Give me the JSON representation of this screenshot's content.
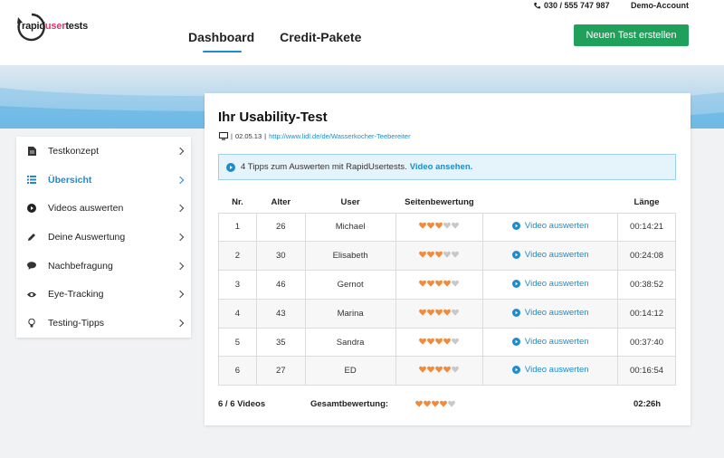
{
  "header": {
    "logo": {
      "part1": "rapid",
      "part2": "user",
      "part3": "tests"
    },
    "nav": [
      {
        "label": "Dashboard",
        "active": true
      },
      {
        "label": "Credit-Pakete",
        "active": false
      }
    ],
    "phone": "030 / 555 747 987",
    "account": "Demo-Account",
    "cta_label": "Neuen Test erstellen"
  },
  "colors": {
    "accent": "#1d8ccc",
    "cta": "#1fa05b",
    "heart_filled": "#f08a3c",
    "heart_empty": "#c8c8c8",
    "logo_pink": "#e8336b"
  },
  "sidebar": {
    "items": [
      {
        "label": "Testkonzept",
        "icon": "document-icon",
        "active": false
      },
      {
        "label": "Übersicht",
        "icon": "list-icon",
        "active": true
      },
      {
        "label": "Videos auswerten",
        "icon": "play-icon",
        "active": false
      },
      {
        "label": "Deine Auswertung",
        "icon": "pencil-icon",
        "active": false
      },
      {
        "label": "Nachbefragung",
        "icon": "speech-bubble-icon",
        "active": false
      },
      {
        "label": "Eye-Tracking",
        "icon": "eye-icon",
        "active": false
      },
      {
        "label": "Testing-Tipps",
        "icon": "lightbulb-icon",
        "active": false
      }
    ]
  },
  "main": {
    "title": "Ihr Usability-Test",
    "date": "02.05.13",
    "url": "http://www.lidl.de/de/Wasserkocher-Teebereiter",
    "tip_text": "4 Tipps zum Auswerten mit RapidUsertests.",
    "tip_link": "Video ansehen.",
    "table": {
      "headers": [
        "Nr.",
        "Alter",
        "User",
        "Seitenbewertung",
        "",
        "Länge"
      ],
      "rows": [
        {
          "nr": "1",
          "age": "26",
          "user": "Michael",
          "rating": 3,
          "video": "Video auswerten",
          "length": "00:14:21"
        },
        {
          "nr": "2",
          "age": "30",
          "user": "Elisabeth",
          "rating": 3,
          "video": "Video auswerten",
          "length": "00:24:08"
        },
        {
          "nr": "3",
          "age": "46",
          "user": "Gernot",
          "rating": 4,
          "video": "Video auswerten",
          "length": "00:38:52"
        },
        {
          "nr": "4",
          "age": "43",
          "user": "Marina",
          "rating": 4,
          "video": "Video auswerten",
          "length": "00:14:12"
        },
        {
          "nr": "5",
          "age": "35",
          "user": "Sandra",
          "rating": 4,
          "video": "Video auswerten",
          "length": "00:37:40"
        },
        {
          "nr": "6",
          "age": "27",
          "user": "ED",
          "rating": 4,
          "video": "Video auswerten",
          "length": "00:16:54"
        }
      ]
    },
    "footer": {
      "videos": "6 / 6 Videos",
      "total_label": "Gesamtbewertung:",
      "total_rating": 4,
      "total_length": "02:26h"
    }
  }
}
